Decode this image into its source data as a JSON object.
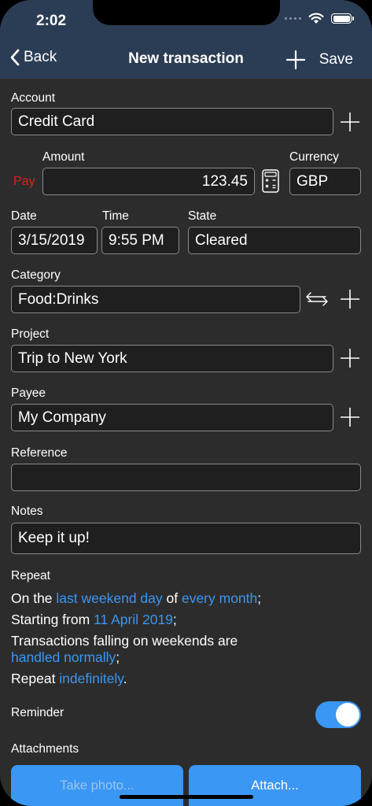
{
  "status": {
    "time": "2:02"
  },
  "nav": {
    "back_label": "Back",
    "title": "New transaction",
    "save_label": "Save"
  },
  "account": {
    "label": "Account",
    "value": "Credit Card"
  },
  "amount": {
    "direction": "Pay",
    "label": "Amount",
    "value": "123.45"
  },
  "currency": {
    "label": "Currency",
    "value": "GBP"
  },
  "date": {
    "label": "Date",
    "value": "3/15/2019"
  },
  "time": {
    "label": "Time",
    "value": "9:55 PM"
  },
  "state": {
    "label": "State",
    "value": "Cleared"
  },
  "category": {
    "label": "Category",
    "value": "Food:Drinks"
  },
  "project": {
    "label": "Project",
    "value": "Trip to New York"
  },
  "payee": {
    "label": "Payee",
    "value": "My Company"
  },
  "reference": {
    "label": "Reference",
    "value": ""
  },
  "notes": {
    "label": "Notes",
    "value": "Keep it up!"
  },
  "repeat": {
    "label": "Repeat",
    "line1_prefix": "On the ",
    "line1_link1": "last weekend day",
    "line1_mid": " of ",
    "line1_link2": "every month",
    "line1_suffix": ";",
    "line2_prefix": "Starting from ",
    "line2_link": "11 April 2019",
    "line2_suffix": ";",
    "line3_text": "Transactions falling on weekends are",
    "line4_link": "handled normally",
    "line4_suffix": ";",
    "line5_prefix": "Repeat ",
    "line5_link": "indefinitely",
    "line5_suffix": "."
  },
  "reminder": {
    "label": "Reminder",
    "enabled": true
  },
  "attachments": {
    "label": "Attachments",
    "take_photo_label": "Take photo...",
    "attach_label": "Attach..."
  },
  "colors": {
    "accent": "#3a97f3",
    "nav_bg": "#2b3d54",
    "pay": "#e0201c",
    "background": "#2c2c2c"
  }
}
